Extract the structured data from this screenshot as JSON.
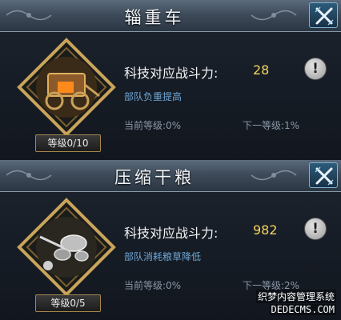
{
  "panels": [
    {
      "title": "辎重车",
      "item_icon": "supply-wagon-icon",
      "level_badge": "等级0/10",
      "power_label": "科技对应战斗力:",
      "power_value": "28",
      "description": "部队负重提高",
      "current_level": "当前等级:0%",
      "next_level": "下一等级:1%"
    },
    {
      "title": "压缩干粮",
      "item_icon": "compressed-rations-icon",
      "level_badge": "等级0/5",
      "power_label": "科技对应战斗力:",
      "power_value": "982",
      "description": "部队消耗粮草降低",
      "current_level": "当前等级:0%",
      "next_level": "下一等级:2%"
    }
  ],
  "watermark": {
    "line1": "织梦内容管理系统",
    "line2": "DEDECMS.COM"
  },
  "colors": {
    "title_bar": "#4a5969",
    "close_button": "#1f4560",
    "power_value": "#f4d35e",
    "description": "#6ea7d6",
    "level_text": "#8a98a8",
    "frame_gold": "#c9a45a"
  }
}
